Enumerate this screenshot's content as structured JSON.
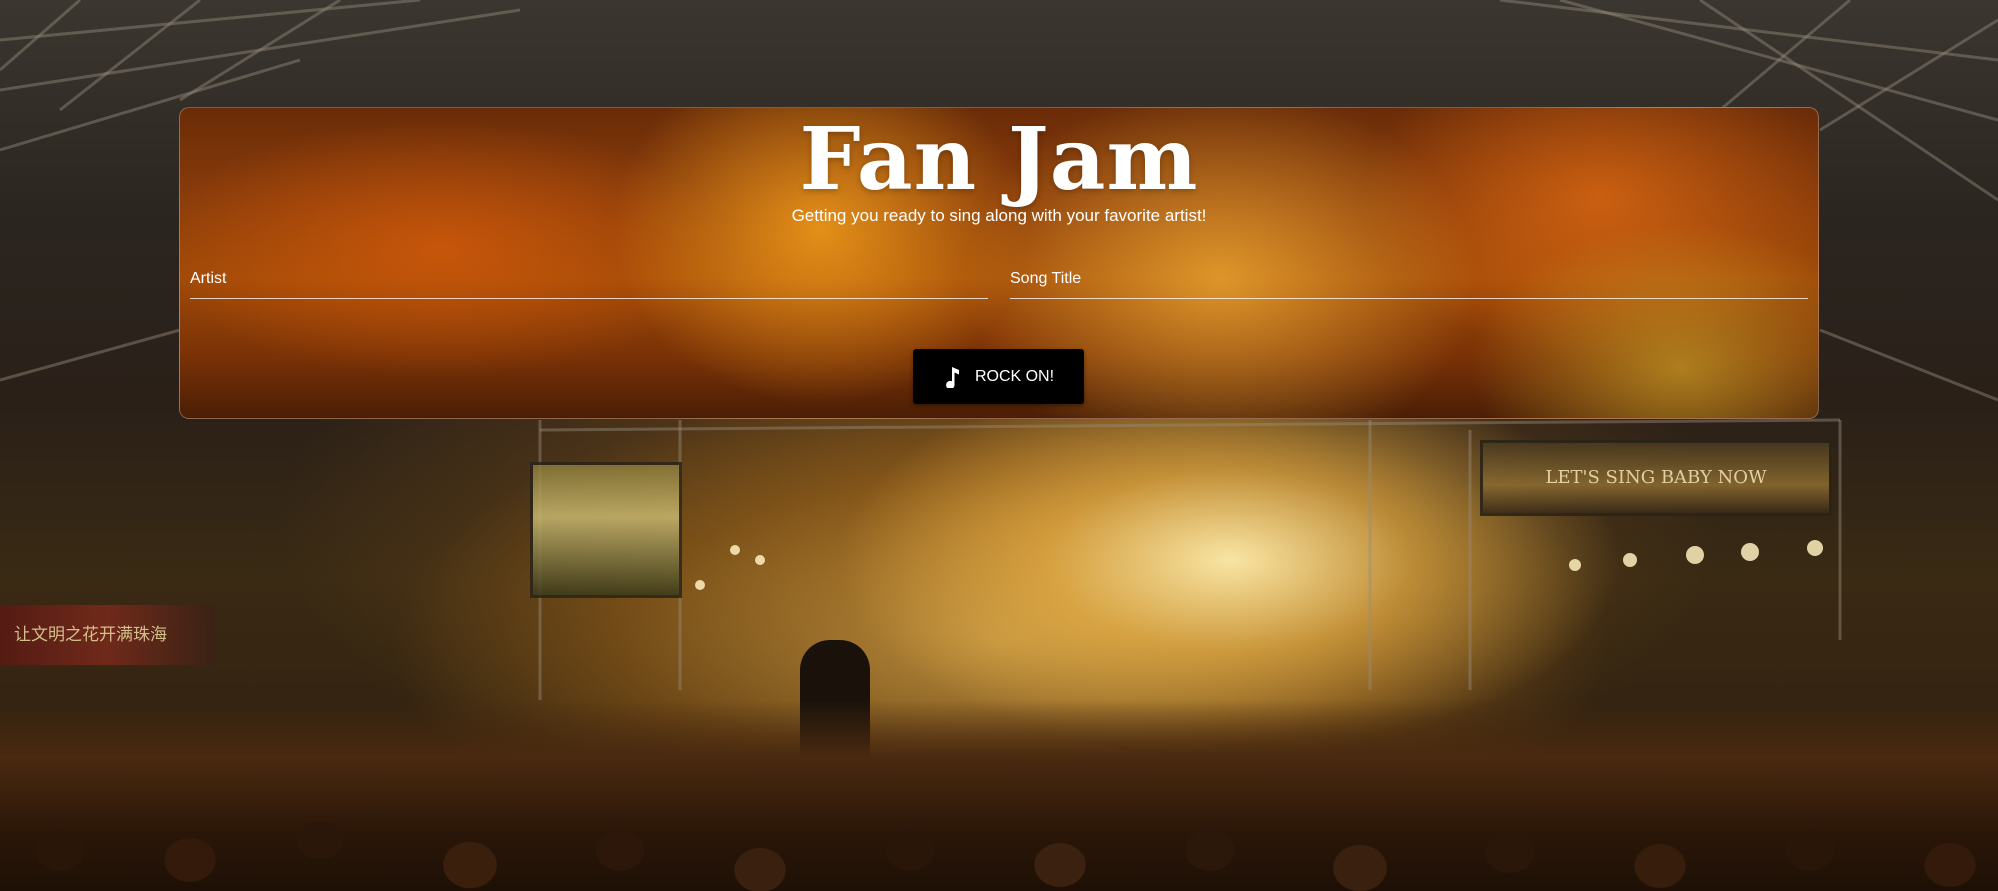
{
  "app": {
    "title": "Fan Jam",
    "subtitle": "Getting you ready to sing along with your favorite artist!"
  },
  "form": {
    "artist": {
      "placeholder": "Artist",
      "value": ""
    },
    "song": {
      "placeholder": "Song Title",
      "value": ""
    },
    "submit": {
      "label": "ROCK ON!",
      "icon": "music-note-icon"
    }
  },
  "background": {
    "banner_text": "让文明之花开满珠海",
    "screen_text": "LET'S SING BABY NOW"
  },
  "colors": {
    "button_bg": "#000000",
    "text": "#ffffff",
    "card_glow": "#e07a10"
  }
}
